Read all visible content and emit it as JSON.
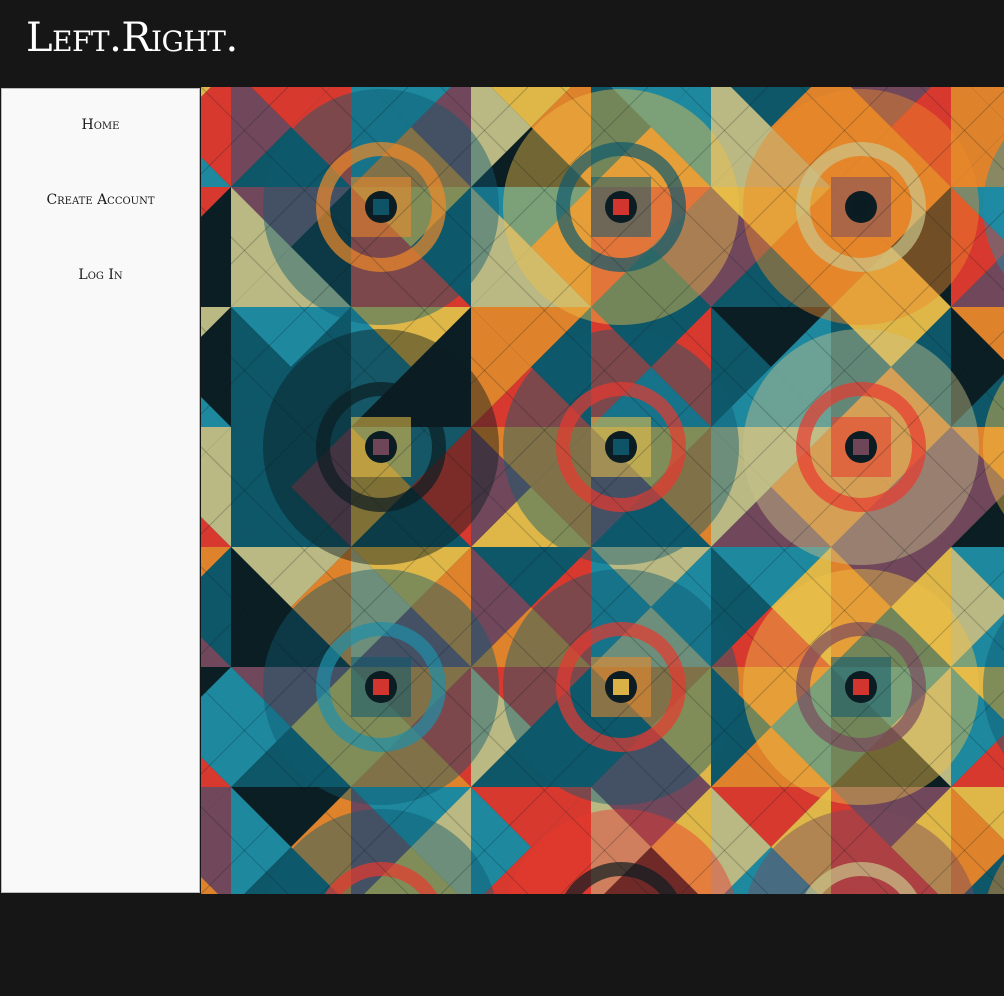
{
  "header": {
    "brand": "Left.Right."
  },
  "sidebar": {
    "items": [
      {
        "label": "Home"
      },
      {
        "label": "Create Account"
      },
      {
        "label": "Log In"
      }
    ]
  },
  "colors": {
    "background": "#161616",
    "sidebar": "#f9f9f9",
    "brand_text": "#ffffff",
    "nav_text": "#1a1a1a"
  },
  "artwork": {
    "description_icon": "geometric-pattern-image",
    "palette": [
      "#0e5a6e",
      "#1f8fa8",
      "#e8392f",
      "#f08a2a",
      "#f0c24a",
      "#c9c48a",
      "#0b1c22",
      "#7a4a5e"
    ]
  }
}
